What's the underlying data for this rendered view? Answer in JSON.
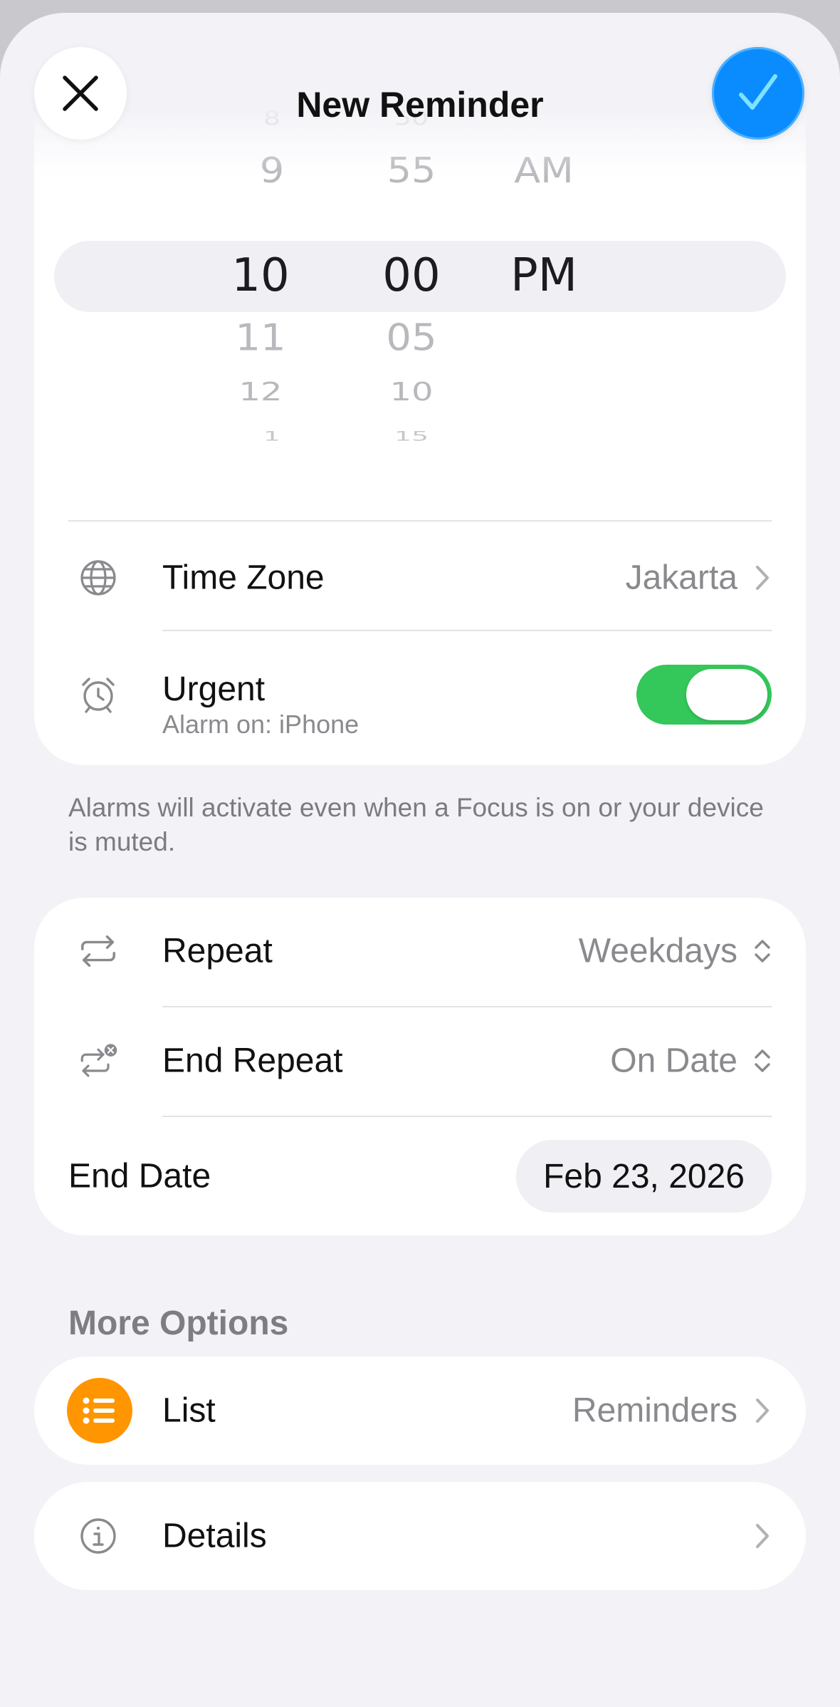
{
  "header": {
    "title": "New Reminder",
    "close_icon": "close-icon",
    "done_icon": "checkmark-icon",
    "accent": "#0a8cff"
  },
  "time_picker": {
    "hours": [
      "8",
      "9",
      "10",
      "11",
      "12",
      "1"
    ],
    "minutes": [
      "50",
      "55",
      "00",
      "05",
      "10",
      "15"
    ],
    "periods": [
      "AM",
      "PM"
    ],
    "selected": {
      "hour": "10",
      "minute": "00",
      "period": "PM"
    }
  },
  "time_zone": {
    "label": "Time Zone",
    "value": "Jakarta",
    "icon": "globe-icon"
  },
  "urgent": {
    "label": "Urgent",
    "sublabel": "Alarm on: iPhone",
    "enabled": true,
    "icon": "alarm-clock-icon",
    "toggle_color": "#34c759"
  },
  "footnote": "Alarms will activate even when a Focus is on or your device is muted.",
  "repeat": {
    "label": "Repeat",
    "value": "Weekdays",
    "icon": "repeat-icon"
  },
  "end_repeat": {
    "label": "End Repeat",
    "value": "On Date",
    "icon": "repeat-off-icon"
  },
  "end_date": {
    "label": "End Date",
    "value": "Feb 23, 2026"
  },
  "more_options": {
    "header": "More Options",
    "list": {
      "label": "List",
      "value": "Reminders",
      "icon": "list-icon",
      "icon_color": "#ff9500"
    },
    "details": {
      "label": "Details",
      "icon": "info-icon"
    }
  }
}
